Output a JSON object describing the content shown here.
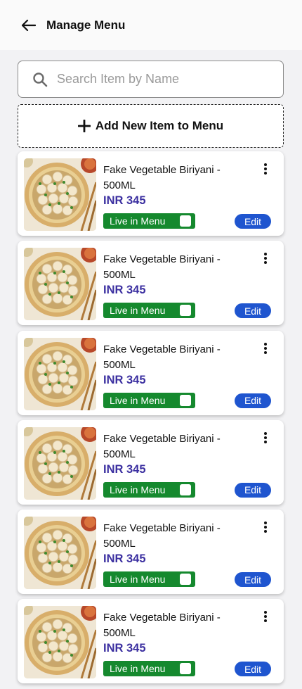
{
  "header": {
    "title": "Manage Menu",
    "back_icon": "arrow-left-icon"
  },
  "search": {
    "placeholder": "Search Item by Name",
    "value": "",
    "icon": "search-icon"
  },
  "add_button": {
    "label": "Add New Item to Menu",
    "icon": "plus-icon"
  },
  "colors": {
    "price": "#3b2fa0",
    "live_toggle": "#15892e",
    "edit_button": "#1f55cf"
  },
  "items": [
    {
      "name": "Fake Vegetable Biriyani - 500ML",
      "price": "INR 345",
      "live_label": "Live in Menu",
      "edit_label": "Edit"
    },
    {
      "name": "Fake Vegetable Biriyani - 500ML",
      "price": "INR 345",
      "live_label": "Live in Menu",
      "edit_label": "Edit"
    },
    {
      "name": "Fake Vegetable Biriyani - 500ML",
      "price": "INR 345",
      "live_label": "Live in Menu",
      "edit_label": "Edit"
    },
    {
      "name": "Fake Vegetable Biriyani - 500ML",
      "price": "INR 345",
      "live_label": "Live in Menu",
      "edit_label": "Edit"
    },
    {
      "name": "Fake Vegetable Biriyani - 500ML",
      "price": "INR 345",
      "live_label": "Live in Menu",
      "edit_label": "Edit"
    },
    {
      "name": "Fake Vegetable Biriyani - 500ML",
      "price": "INR 345",
      "live_label": "Live in Menu",
      "edit_label": "Edit"
    }
  ]
}
